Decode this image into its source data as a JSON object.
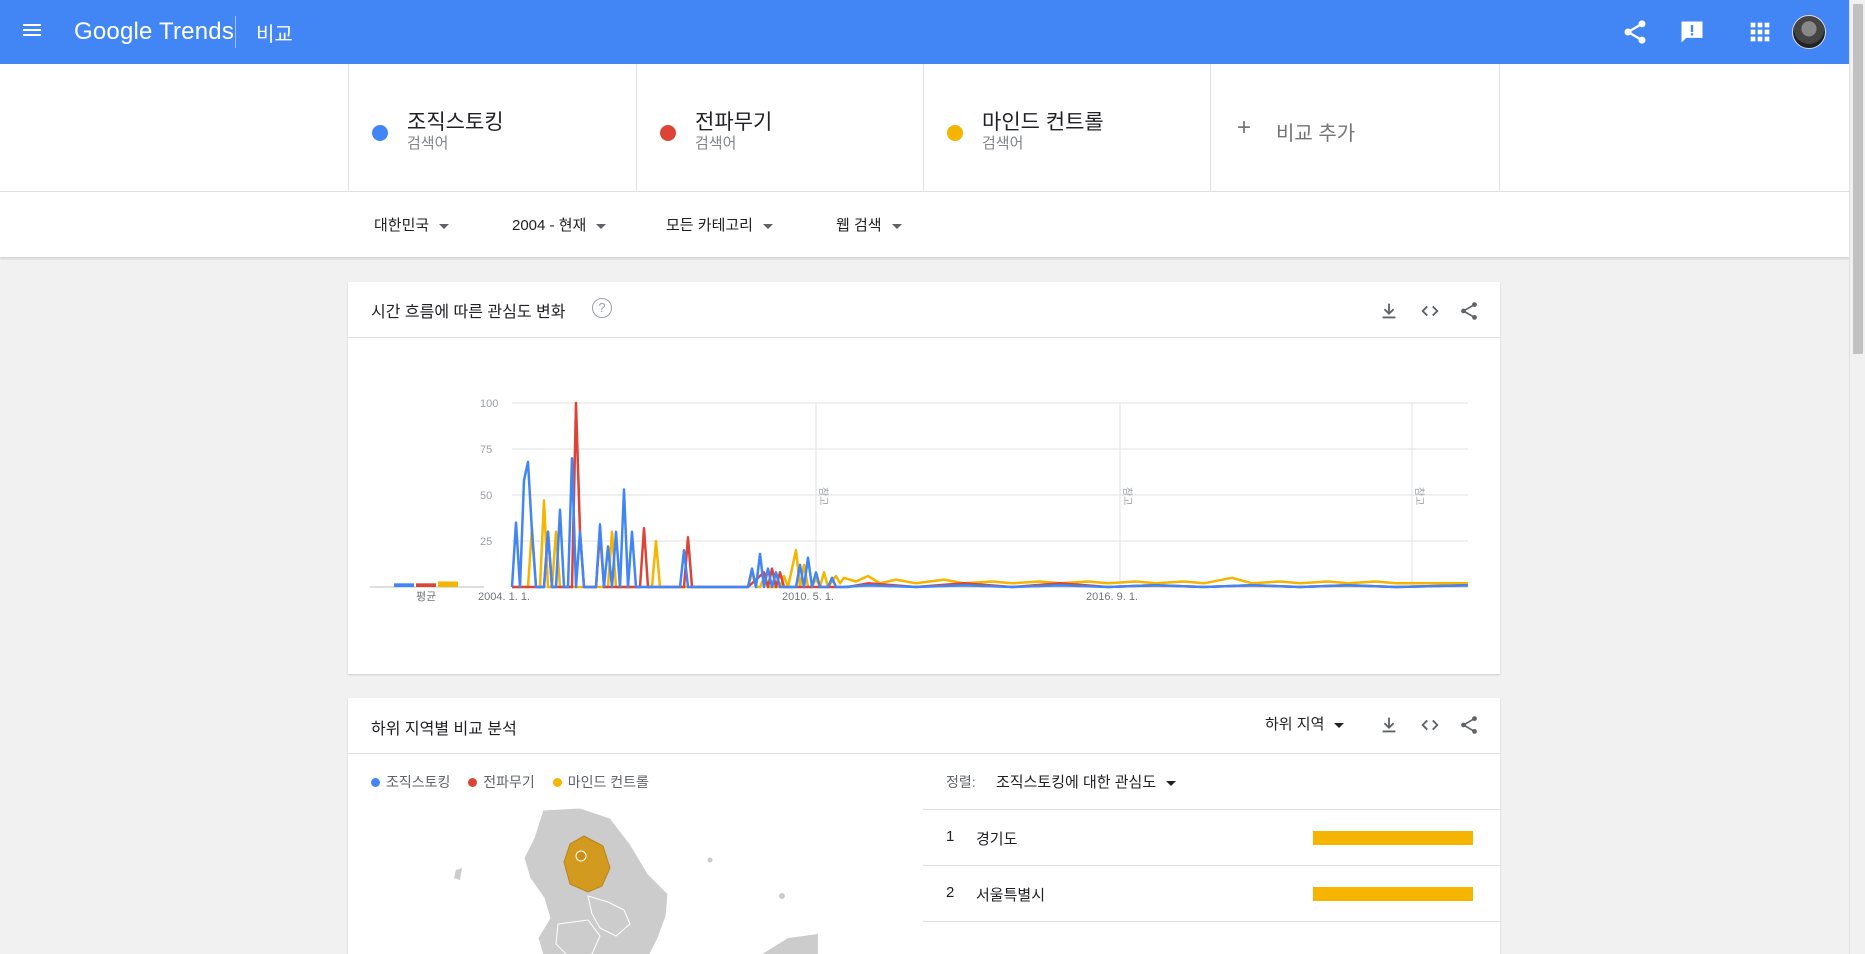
{
  "header": {
    "logo": "Google Trends",
    "title": "비교",
    "colors": {
      "bar": "#4285f4"
    }
  },
  "terms": [
    {
      "name": "조직스토킹",
      "sub": "검색어",
      "color": "#4285f4"
    },
    {
      "name": "전파무기",
      "sub": "검색어",
      "color": "#db4437"
    },
    {
      "name": "마인드 컨트롤",
      "sub": "검색어",
      "color": "#f4b400"
    }
  ],
  "add_compare": {
    "plus": "+",
    "label": "비교 추가"
  },
  "filters": {
    "region": "대한민국",
    "period": "2004 - 현재",
    "category": "모든 카테고리",
    "search_type": "웹 검색"
  },
  "interest_card": {
    "title": "시간 흐름에 따른 관심도 변화",
    "help": "?",
    "icons": [
      "download-icon",
      "embed-code-icon",
      "share-icon"
    ]
  },
  "chart_data": {
    "type": "line",
    "title": "",
    "ylim": [
      0,
      100
    ],
    "y_ticks": [
      "100",
      "75",
      "50",
      "25"
    ],
    "x_tick_labels": [
      "2004. 1. 1.",
      "2010. 5. 1.",
      "2016. 9. 1."
    ],
    "note_label": "참고",
    "avg_label": "평균",
    "averages": [
      2,
      2,
      3
    ],
    "x_start": "2004-01",
    "x_end": "2023-12",
    "series": [
      {
        "name": "조직스토킹",
        "color": "#4285f4",
        "points": [
          [
            "2004-01",
            0
          ],
          [
            "2004-02",
            35
          ],
          [
            "2004-03",
            0
          ],
          [
            "2004-04",
            58
          ],
          [
            "2004-05",
            68
          ],
          [
            "2004-06",
            30
          ],
          [
            "2004-07",
            0
          ],
          [
            "2004-08",
            0
          ],
          [
            "2004-09",
            0
          ],
          [
            "2004-10",
            30
          ],
          [
            "2004-11",
            0
          ],
          [
            "2004-12",
            0
          ],
          [
            "2005-01",
            42
          ],
          [
            "2005-02",
            0
          ],
          [
            "2005-03",
            0
          ],
          [
            "2005-04",
            70
          ],
          [
            "2005-05",
            0
          ],
          [
            "2005-06",
            30
          ],
          [
            "2005-07",
            0
          ],
          [
            "2005-08",
            0
          ],
          [
            "2005-09",
            0
          ],
          [
            "2005-10",
            0
          ],
          [
            "2005-11",
            34
          ],
          [
            "2005-12",
            0
          ],
          [
            "2006-01",
            22
          ],
          [
            "2006-02",
            0
          ],
          [
            "2006-03",
            30
          ],
          [
            "2006-04",
            0
          ],
          [
            "2006-05",
            53
          ],
          [
            "2006-06",
            0
          ],
          [
            "2006-07",
            30
          ],
          [
            "2006-08",
            0
          ],
          [
            "2006-09",
            0
          ],
          [
            "2006-10",
            0
          ],
          [
            "2006-11",
            0
          ],
          [
            "2006-12",
            0
          ],
          [
            "2007-01",
            0
          ],
          [
            "2007-02",
            0
          ],
          [
            "2007-03",
            0
          ],
          [
            "2007-04",
            0
          ],
          [
            "2007-05",
            0
          ],
          [
            "2007-06",
            0
          ],
          [
            "2007-07",
            0
          ],
          [
            "2007-08",
            20
          ],
          [
            "2007-09",
            0
          ],
          [
            "2007-10",
            0
          ],
          [
            "2007-11",
            0
          ],
          [
            "2007-12",
            0
          ],
          [
            "2008-01",
            0
          ],
          [
            "2008-02",
            0
          ],
          [
            "2008-03",
            0
          ],
          [
            "2008-04",
            0
          ],
          [
            "2008-05",
            0
          ],
          [
            "2008-06",
            0
          ],
          [
            "2008-07",
            0
          ],
          [
            "2008-08",
            0
          ],
          [
            "2008-09",
            0
          ],
          [
            "2008-10",
            0
          ],
          [
            "2008-11",
            0
          ],
          [
            "2008-12",
            0
          ],
          [
            "2009-01",
            10
          ],
          [
            "2009-02",
            0
          ],
          [
            "2009-03",
            18
          ],
          [
            "2009-04",
            0
          ],
          [
            "2009-05",
            10
          ],
          [
            "2009-06",
            0
          ],
          [
            "2009-07",
            8
          ],
          [
            "2009-08",
            0
          ],
          [
            "2009-09",
            0
          ],
          [
            "2009-10",
            0
          ],
          [
            "2009-11",
            0
          ],
          [
            "2009-12",
            0
          ],
          [
            "2010-01",
            12
          ],
          [
            "2010-02",
            0
          ],
          [
            "2010-03",
            16
          ],
          [
            "2010-04",
            0
          ],
          [
            "2010-05",
            8
          ],
          [
            "2010-06",
            0
          ],
          [
            "2010-07",
            0
          ],
          [
            "2010-08",
            0
          ],
          [
            "2010-09",
            5
          ],
          [
            "2010-10",
            0
          ],
          [
            "2010-11",
            0
          ],
          [
            "2010-12",
            0
          ],
          [
            "2011-06",
            1
          ],
          [
            "2012-06",
            0
          ],
          [
            "2013-06",
            1
          ],
          [
            "2014-06",
            0
          ],
          [
            "2015-06",
            1
          ],
          [
            "2016-06",
            0
          ],
          [
            "2017-06",
            1
          ],
          [
            "2018-06",
            0
          ],
          [
            "2019-06",
            1
          ],
          [
            "2020-06",
            0
          ],
          [
            "2021-06",
            1
          ],
          [
            "2022-06",
            0
          ],
          [
            "2023-12",
            1
          ]
        ]
      },
      {
        "name": "전파무기",
        "color": "#db4437",
        "points": [
          [
            "2004-01",
            0
          ],
          [
            "2004-02",
            0
          ],
          [
            "2004-03",
            0
          ],
          [
            "2004-04",
            0
          ],
          [
            "2004-05",
            0
          ],
          [
            "2004-06",
            0
          ],
          [
            "2004-07",
            0
          ],
          [
            "2004-08",
            0
          ],
          [
            "2004-09",
            0
          ],
          [
            "2004-10",
            30
          ],
          [
            "2004-11",
            0
          ],
          [
            "2004-12",
            0
          ],
          [
            "2005-01",
            0
          ],
          [
            "2005-02",
            0
          ],
          [
            "2005-03",
            0
          ],
          [
            "2005-04",
            0
          ],
          [
            "2005-05",
            100
          ],
          [
            "2005-06",
            30
          ],
          [
            "2005-07",
            0
          ],
          [
            "2005-08",
            0
          ],
          [
            "2005-09",
            0
          ],
          [
            "2005-10",
            0
          ],
          [
            "2005-11",
            30
          ],
          [
            "2005-12",
            0
          ],
          [
            "2006-01",
            0
          ],
          [
            "2006-02",
            0
          ],
          [
            "2006-03",
            0
          ],
          [
            "2006-04",
            0
          ],
          [
            "2006-05",
            0
          ],
          [
            "2006-06",
            0
          ],
          [
            "2006-07",
            0
          ],
          [
            "2006-08",
            0
          ],
          [
            "2006-09",
            0
          ],
          [
            "2006-10",
            32
          ],
          [
            "2006-11",
            0
          ],
          [
            "2006-12",
            0
          ],
          [
            "2007-01",
            0
          ],
          [
            "2007-02",
            0
          ],
          [
            "2007-03",
            0
          ],
          [
            "2007-04",
            0
          ],
          [
            "2007-05",
            0
          ],
          [
            "2007-06",
            0
          ],
          [
            "2007-07",
            0
          ],
          [
            "2007-08",
            0
          ],
          [
            "2007-09",
            27
          ],
          [
            "2007-10",
            0
          ],
          [
            "2007-11",
            0
          ],
          [
            "2007-12",
            0
          ],
          [
            "2008-12",
            0
          ],
          [
            "2009-04",
            8
          ],
          [
            "2009-05",
            0
          ],
          [
            "2009-06",
            10
          ],
          [
            "2009-07",
            0
          ],
          [
            "2009-08",
            8
          ],
          [
            "2009-09",
            0
          ],
          [
            "2009-10",
            0
          ],
          [
            "2011-01",
            0
          ],
          [
            "2011-06",
            2
          ],
          [
            "2012-06",
            0
          ],
          [
            "2013-06",
            2
          ],
          [
            "2014-06",
            0
          ],
          [
            "2015-06",
            2
          ],
          [
            "2016-06",
            0
          ],
          [
            "2017-06",
            1
          ],
          [
            "2018-06",
            0
          ],
          [
            "2019-06",
            1
          ],
          [
            "2020-06",
            0
          ],
          [
            "2021-06",
            1
          ],
          [
            "2022-06",
            0
          ],
          [
            "2023-12",
            1
          ]
        ]
      },
      {
        "name": "마인드 컨트롤",
        "color": "#f4b400",
        "points": [
          [
            "2004-01",
            0
          ],
          [
            "2004-02",
            0
          ],
          [
            "2004-03",
            0
          ],
          [
            "2004-04",
            0
          ],
          [
            "2004-05",
            0
          ],
          [
            "2004-06",
            32
          ],
          [
            "2004-07",
            0
          ],
          [
            "2004-08",
            0
          ],
          [
            "2004-09",
            47
          ],
          [
            "2004-10",
            0
          ],
          [
            "2004-11",
            0
          ],
          [
            "2004-12",
            30
          ],
          [
            "2005-01",
            0
          ],
          [
            "2005-02",
            0
          ],
          [
            "2005-03",
            0
          ],
          [
            "2005-04",
            0
          ],
          [
            "2005-05",
            0
          ],
          [
            "2005-06",
            0
          ],
          [
            "2005-07",
            0
          ],
          [
            "2005-08",
            0
          ],
          [
            "2005-09",
            0
          ],
          [
            "2005-10",
            0
          ],
          [
            "2005-11",
            0
          ],
          [
            "2005-12",
            0
          ],
          [
            "2006-01",
            0
          ],
          [
            "2006-02",
            30
          ],
          [
            "2006-03",
            0
          ],
          [
            "2006-04",
            0
          ],
          [
            "2006-05",
            0
          ],
          [
            "2006-06",
            0
          ],
          [
            "2006-07",
            0
          ],
          [
            "2006-08",
            0
          ],
          [
            "2006-09",
            0
          ],
          [
            "2006-10",
            0
          ],
          [
            "2006-11",
            0
          ],
          [
            "2006-12",
            0
          ],
          [
            "2007-01",
            25
          ],
          [
            "2007-02",
            0
          ],
          [
            "2007-03",
            0
          ],
          [
            "2007-04",
            0
          ],
          [
            "2007-05",
            0
          ],
          [
            "2007-06",
            0
          ],
          [
            "2007-07",
            0
          ],
          [
            "2007-08",
            0
          ],
          [
            "2007-09",
            0
          ],
          [
            "2007-10",
            0
          ],
          [
            "2007-11",
            0
          ],
          [
            "2007-12",
            0
          ],
          [
            "2008-12",
            0
          ],
          [
            "2009-01",
            8
          ],
          [
            "2009-02",
            0
          ],
          [
            "2009-03",
            0
          ],
          [
            "2009-04",
            5
          ],
          [
            "2009-05",
            0
          ],
          [
            "2009-06",
            0
          ],
          [
            "2009-07",
            0
          ],
          [
            "2009-08",
            0
          ],
          [
            "2009-09",
            6
          ],
          [
            "2009-10",
            0
          ],
          [
            "2009-11",
            10
          ],
          [
            "2009-12",
            20
          ],
          [
            "2010-01",
            0
          ],
          [
            "2010-02",
            12
          ],
          [
            "2010-03",
            0
          ],
          [
            "2010-04",
            0
          ],
          [
            "2010-05",
            5
          ],
          [
            "2010-06",
            0
          ],
          [
            "2010-07",
            8
          ],
          [
            "2010-08",
            0
          ],
          [
            "2010-09",
            3
          ],
          [
            "2010-10",
            6
          ],
          [
            "2010-11",
            2
          ],
          [
            "2010-12",
            5
          ],
          [
            "2011-03",
            3
          ],
          [
            "2011-06",
            6
          ],
          [
            "2011-09",
            2
          ],
          [
            "2012-01",
            4
          ],
          [
            "2012-06",
            2
          ],
          [
            "2013-01",
            4
          ],
          [
            "2013-06",
            2
          ],
          [
            "2014-01",
            3
          ],
          [
            "2014-06",
            2
          ],
          [
            "2015-01",
            3
          ],
          [
            "2015-06",
            2
          ],
          [
            "2016-01",
            3
          ],
          [
            "2016-06",
            2
          ],
          [
            "2017-01",
            3
          ],
          [
            "2017-06",
            2
          ],
          [
            "2018-01",
            3
          ],
          [
            "2018-06",
            2
          ],
          [
            "2019-01",
            5
          ],
          [
            "2019-06",
            2
          ],
          [
            "2020-01",
            3
          ],
          [
            "2020-06",
            2
          ],
          [
            "2021-01",
            3
          ],
          [
            "2021-06",
            2
          ],
          [
            "2022-01",
            3
          ],
          [
            "2022-06",
            2
          ],
          [
            "2023-12",
            2
          ]
        ]
      }
    ]
  },
  "region_card": {
    "title": "하위 지역별 비교 분석",
    "subregion_label": "하위 지역",
    "legend": [
      "조직스토킹",
      "전파무기",
      "마인드 컨트롤"
    ],
    "sort_label": "정렬:",
    "sort_value": "조직스토킹에 대한 관심도",
    "regions": [
      {
        "rank": "1",
        "name": "경기도",
        "share": 1.0,
        "color": "#f4b400"
      },
      {
        "rank": "2",
        "name": "서울특별시",
        "share": 1.0,
        "color": "#f4b400"
      }
    ],
    "map_highlight_color": "#d29a1f",
    "map_base_color": "#cccccc"
  }
}
